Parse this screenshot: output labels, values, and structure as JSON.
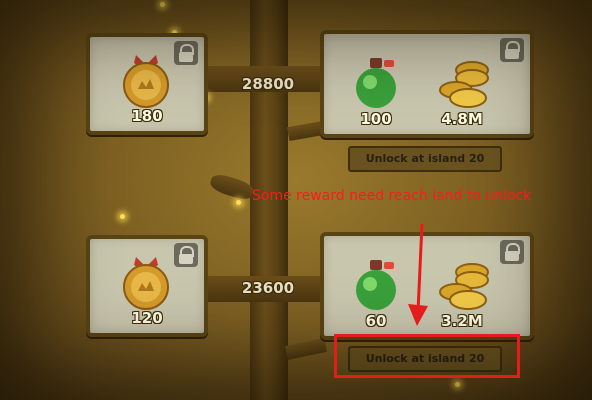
{
  "rewards": [
    {
      "milestone": "28800",
      "free": {
        "icon": "medal-icon",
        "quantity": "180"
      },
      "premium": [
        {
          "icon": "potion-bottle-icon",
          "quantity": "100"
        },
        {
          "icon": "gold-coins-icon",
          "quantity": "4.8M"
        }
      ],
      "unlock_text": "Unlock at island 20"
    },
    {
      "milestone": "23600",
      "free": {
        "icon": "medal-icon",
        "quantity": "120"
      },
      "premium": [
        {
          "icon": "potion-bottle-icon",
          "quantity": "60"
        },
        {
          "icon": "gold-coins-icon",
          "quantity": "3.2M"
        }
      ],
      "unlock_text": "Unlock at island 20"
    }
  ],
  "annotation": {
    "text": "Some reward need reach land to unlock",
    "color": "#ff1a1a"
  }
}
